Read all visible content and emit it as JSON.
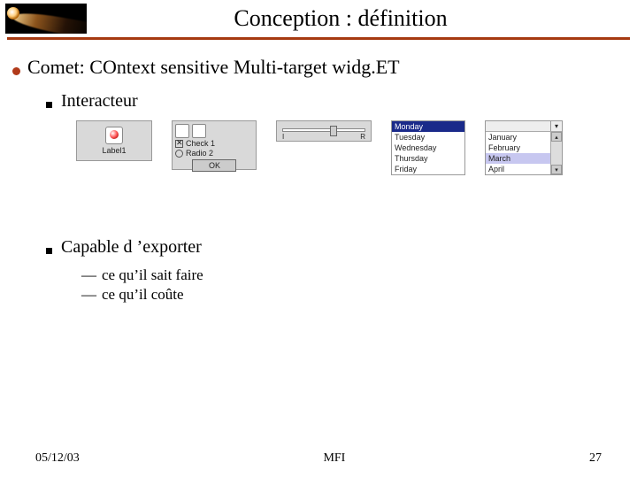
{
  "header": {
    "title": "Conception : définition"
  },
  "main": {
    "line1": "Comet: COntext sensitive Multi-target widg.ET",
    "sub1": "Interacteur",
    "sub2": "Capable d ’exporter",
    "sub2_items": [
      "ce qu’il sait faire",
      "ce qu’il coûte"
    ]
  },
  "widgets": {
    "label_widget": {
      "caption": "Label1"
    },
    "check_widget": {
      "check_label": "Check 1",
      "radio_label": "Radio 2",
      "ok": "OK"
    },
    "slider_widget": {
      "left": "I",
      "right": "R"
    },
    "days_widget": {
      "options": [
        "Monday",
        "Tuesday",
        "Wednesday",
        "Thursday",
        "Friday"
      ],
      "selected_index": 0
    },
    "months_widget": {
      "options": [
        "January",
        "February",
        "March",
        "April"
      ],
      "selected_index": 2
    }
  },
  "footer": {
    "date": "05/12/03",
    "center": "MFI",
    "page": "27"
  }
}
